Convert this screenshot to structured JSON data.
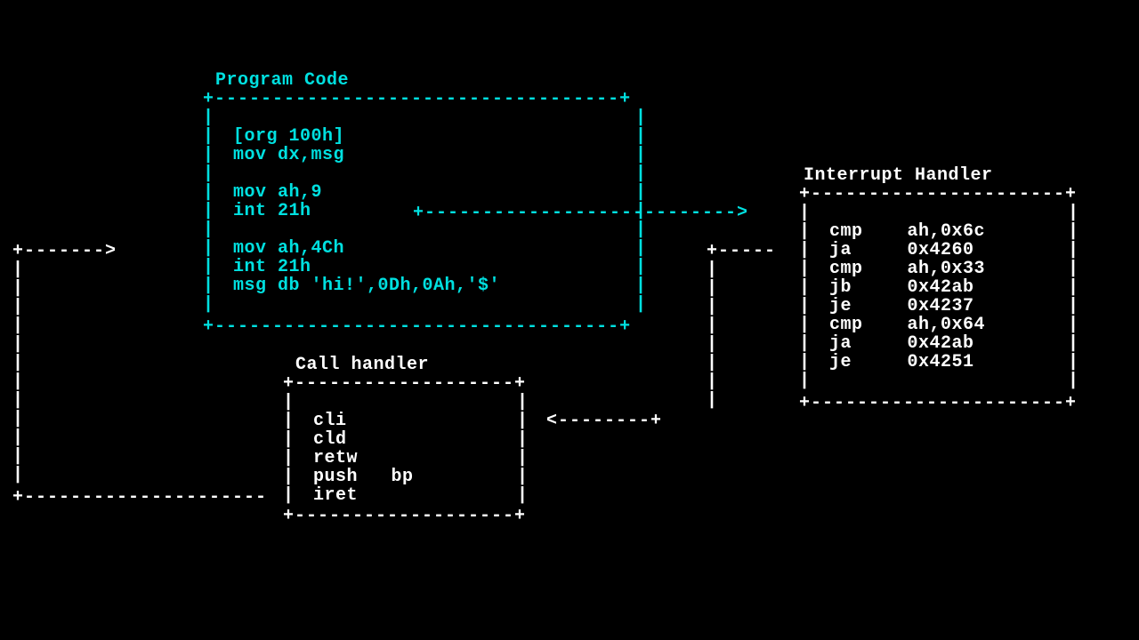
{
  "colors": {
    "background": "#000000",
    "cyan": "#00e0e0",
    "white": "#ffffff"
  },
  "program_box": {
    "title": "Program Code",
    "lines": [
      "[org 100h]",
      "mov dx,msg",
      "",
      "mov ah,9",
      "int 21h",
      "",
      "mov ah,4Ch",
      "int 21h",
      "msg db 'hi!',0Dh,0Ah,'$'"
    ]
  },
  "interrupt_box": {
    "title": "Interrupt Handler",
    "lines": [
      "cmp    ah,0x6c",
      "ja     0x4260",
      "cmp    ah,0x33",
      "jb     0x42ab",
      "je     0x4237",
      "cmp    ah,0x64",
      "ja     0x42ab",
      "je     0x4251"
    ]
  },
  "call_box": {
    "title": "Call handler",
    "lines": [
      "cli",
      "cld",
      "retw",
      "push   bp",
      "iret"
    ]
  }
}
